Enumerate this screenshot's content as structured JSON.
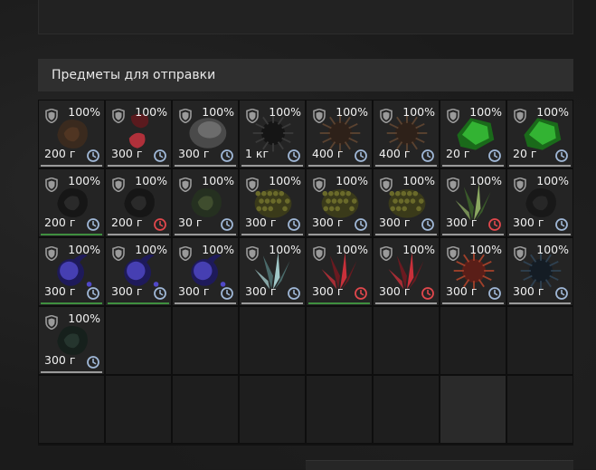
{
  "section": {
    "title": "Предметы для отправки"
  },
  "items": [
    {
      "pct": "100%",
      "weight": "200 г",
      "timer": "normal",
      "art": "artifact-brown",
      "bar": "gray"
    },
    {
      "pct": "100%",
      "weight": "300 г",
      "timer": "normal",
      "art": "artifact-red-flower",
      "bar": "gray"
    },
    {
      "pct": "100%",
      "weight": "300 г",
      "timer": "normal",
      "art": "artifact-gray-stone",
      "bar": "gray"
    },
    {
      "pct": "100%",
      "weight": "1 кг",
      "timer": "normal",
      "art": "artifact-black-spiky",
      "bar": "gray"
    },
    {
      "pct": "100%",
      "weight": "400 г",
      "timer": "normal",
      "art": "artifact-brown-urchin",
      "bar": "gray"
    },
    {
      "pct": "100%",
      "weight": "400 г",
      "timer": "normal",
      "art": "artifact-brown-urchin",
      "bar": "gray"
    },
    {
      "pct": "100%",
      "weight": "20 г",
      "timer": "normal",
      "art": "artifact-green-crystal",
      "bar": "gray"
    },
    {
      "pct": "100%",
      "weight": "20 г",
      "timer": "normal",
      "art": "artifact-green-crystal",
      "bar": "gray"
    },
    {
      "pct": "100%",
      "weight": "200 г",
      "timer": "normal",
      "art": "artifact-dark-coil",
      "bar": "green"
    },
    {
      "pct": "100%",
      "weight": "200 г",
      "timer": "warning",
      "art": "artifact-dark-coil",
      "bar": "gray"
    },
    {
      "pct": "100%",
      "weight": "30 г",
      "timer": "normal",
      "art": "artifact-green-moss",
      "bar": "gray"
    },
    {
      "pct": "100%",
      "weight": "300 г",
      "timer": "normal",
      "art": "artifact-yellow-sponge",
      "bar": "gray"
    },
    {
      "pct": "100%",
      "weight": "300 г",
      "timer": "normal",
      "art": "artifact-yellow-sponge",
      "bar": "gray"
    },
    {
      "pct": "100%",
      "weight": "300 г",
      "timer": "normal",
      "art": "artifact-yellow-sponge",
      "bar": "gray"
    },
    {
      "pct": "100%",
      "weight": "300 г",
      "timer": "warning",
      "art": "artifact-green-leaf",
      "bar": "gray"
    },
    {
      "pct": "100%",
      "weight": "300 г",
      "timer": "normal",
      "art": "artifact-dark-tentacle",
      "bar": "gray"
    },
    {
      "pct": "100%",
      "weight": "300 г",
      "timer": "normal",
      "art": "artifact-blue-orb",
      "bar": "green"
    },
    {
      "pct": "100%",
      "weight": "300 г",
      "timer": "normal",
      "art": "artifact-blue-orb",
      "bar": "green"
    },
    {
      "pct": "100%",
      "weight": "300 г",
      "timer": "normal",
      "art": "artifact-blue-orb",
      "bar": "gray"
    },
    {
      "pct": "100%",
      "weight": "300 г",
      "timer": "normal",
      "art": "artifact-ice-crystal",
      "bar": "gray"
    },
    {
      "pct": "100%",
      "weight": "300 г",
      "timer": "warning",
      "art": "artifact-red-crystal",
      "bar": "green"
    },
    {
      "pct": "100%",
      "weight": "300 г",
      "timer": "warning",
      "art": "artifact-red-crystal",
      "bar": "gray"
    },
    {
      "pct": "100%",
      "weight": "300 г",
      "timer": "normal",
      "art": "artifact-red-spiky",
      "bar": "gray"
    },
    {
      "pct": "100%",
      "weight": "300 г",
      "timer": "normal",
      "art": "artifact-dark-blue-spiky",
      "bar": "gray"
    },
    {
      "pct": "100%",
      "weight": "300 г",
      "timer": "normal",
      "art": "artifact-dark-green-coil",
      "bar": "gray"
    }
  ],
  "empty_slots": 15,
  "colors": {
    "header_bg": "#2f2f2f",
    "timer_normal": "#9fb7d6",
    "timer_warning": "#e0474c",
    "shield": "#9a9a9a",
    "bar_green": "#3f8f3f"
  }
}
